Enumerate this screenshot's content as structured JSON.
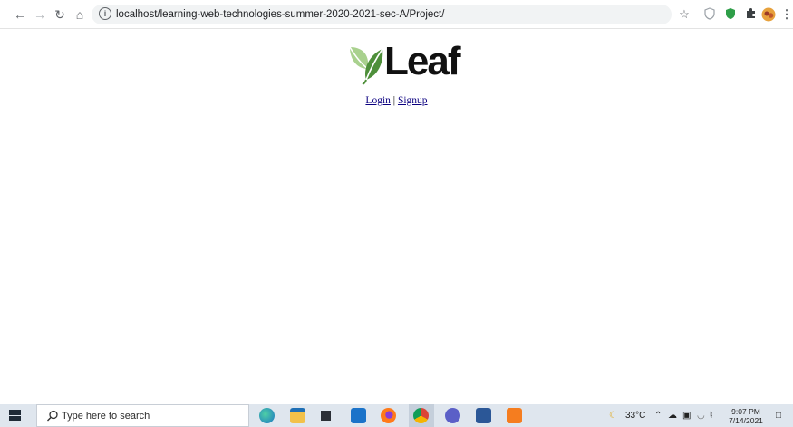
{
  "browser": {
    "url": "localhost/learning-web-technologies-summer-2020-2021-sec-A/Project/",
    "icons": [
      "back-arrow-icon",
      "forward-arrow-icon",
      "reload-icon",
      "home-icon",
      "info-icon",
      "bookmark-star-icon",
      "shield-extension-icon",
      "green-shield-extension-icon",
      "puzzle-extensions-icon",
      "profile-avatar-icon",
      "kebab-menu-icon"
    ]
  },
  "page": {
    "logo_text": "Leaf",
    "login_label": "Login",
    "separator": " | ",
    "signup_label": "Signup",
    "colors": {
      "leaf_light": "#a9d18e",
      "leaf_dark": "#4e8f3a",
      "link": "#0b0080"
    }
  },
  "taskbar": {
    "search_placeholder": "Type here to search",
    "weather": "33°C",
    "time": "9:07 PM",
    "date": "7/14/2021",
    "icons": [
      "windows-start-icon",
      "search-icon",
      "edge-icon",
      "file-explorer-icon",
      "store-icon",
      "mail-icon",
      "firefox-icon",
      "chrome-icon",
      "teams-icon",
      "word-icon",
      "xampp-icon",
      "weather-icon",
      "chevron-up-icon",
      "cloud-icon",
      "keyboard-icon",
      "wifi-icon",
      "volume-icon",
      "notification-icon"
    ]
  }
}
